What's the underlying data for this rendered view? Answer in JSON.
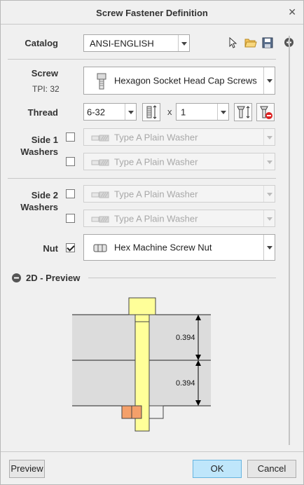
{
  "window": {
    "title": "Screw Fastener Definition"
  },
  "catalog": {
    "label": "Catalog",
    "value": "ANSI-ENGLISH"
  },
  "screw": {
    "label": "Screw",
    "tpi": "TPI: 32",
    "value": "Hexagon Socket Head Cap Screws"
  },
  "thread": {
    "label": "Thread",
    "size": "6-32",
    "times": "x",
    "count": "1"
  },
  "side1": {
    "label_line1": "Side 1",
    "label_line2": "Washers",
    "washer1": "Type A Plain Washer",
    "washer2": "Type A Plain Washer"
  },
  "side2": {
    "label_line1": "Side 2",
    "label_line2": "Washers",
    "washer1": "Type A Plain Washer",
    "washer2": "Type A Plain Washer"
  },
  "nut": {
    "label": "Nut",
    "checked": true,
    "value": "Hex Machine Screw Nut"
  },
  "preview": {
    "section_label": "2D - Preview",
    "dim1": "0.394",
    "dim2": "0.394"
  },
  "footer": {
    "preview_label": "Preview",
    "ok_label": "OK",
    "cancel_label": "Cancel"
  },
  "colors": {
    "accent": "#bfe6fb",
    "screw_fill": "#ffff99",
    "nut_fill": "#f4a06a",
    "plate_fill": "#dcdcdc"
  }
}
